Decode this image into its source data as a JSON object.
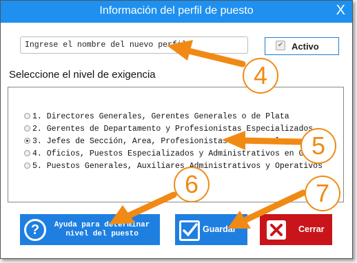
{
  "window": {
    "title": "Información del perfil de puesto"
  },
  "form": {
    "name_placeholder": "Ingrese el nombre del nuevo perfil",
    "active_label": "Activo",
    "active_checked": true,
    "level_prompt": "Seleccione el nivel de exigencia"
  },
  "levels": [
    {
      "label": "1. Directores Generales, Gerentes Generales o de Plata",
      "selected": false
    },
    {
      "label": "2. Gerentes de Departamento y Profesionistas Especializados",
      "selected": false
    },
    {
      "label": "3. Jefes de Sección, Area, Profesionistas en General",
      "selected": true
    },
    {
      "label": "4. Oficios, Puestos Especializados y Administrativos en General",
      "selected": false
    },
    {
      "label": "5. Puestos Generales, Auxiliares Administrativos y Operativos",
      "selected": false
    }
  ],
  "buttons": {
    "help_label": "Ayuda para determinar nivel del puesto",
    "save_label": "Guardar",
    "close_label": "Cerrar"
  },
  "annotations": [
    "4",
    "5",
    "6",
    "7"
  ],
  "colors": {
    "titlebar": "#1e90f0",
    "primary": "#1e7fe0",
    "danger": "#c8141a",
    "annotation": "#f08a14"
  }
}
